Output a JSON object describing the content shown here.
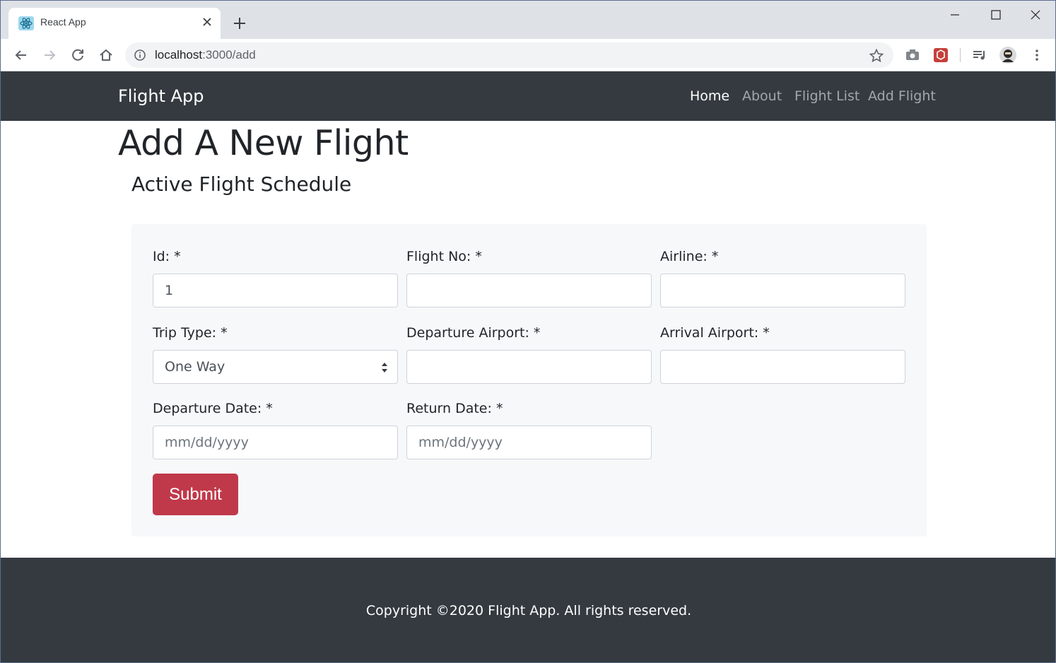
{
  "browser": {
    "tab": {
      "title": "React App"
    },
    "url": {
      "host": "localhost",
      "path": ":3000/add"
    }
  },
  "navbar": {
    "brand": "Flight App",
    "links": [
      {
        "label": "Home",
        "active": true
      },
      {
        "label": "About",
        "active": false
      },
      {
        "label": "Flight List",
        "active": false
      },
      {
        "label": "Add Flight",
        "active": false
      }
    ]
  },
  "main": {
    "title": "Add A New Flight",
    "subtitle": "Active Flight Schedule"
  },
  "form": {
    "id": {
      "label": "Id: *",
      "value": "1"
    },
    "flight_no": {
      "label": "Flight No: *",
      "value": ""
    },
    "airline": {
      "label": "Airline: *",
      "value": ""
    },
    "trip_type": {
      "label": "Trip Type: *",
      "selected": "One Way"
    },
    "departure_airport": {
      "label": "Departure Airport: *",
      "value": ""
    },
    "arrival_airport": {
      "label": "Arrival Airport: *",
      "value": ""
    },
    "departure_date": {
      "label": "Departure Date: *",
      "placeholder": "mm/dd/yyyy"
    },
    "return_date": {
      "label": "Return Date: *",
      "placeholder": "mm/dd/yyyy"
    },
    "submit_label": "Submit"
  },
  "footer": {
    "copyright": "Copyright ©2020 Flight App. All rights reserved."
  },
  "colors": {
    "navbar": "#343a40",
    "submit": "#c0394a",
    "form_bg": "#f7f8fa"
  }
}
